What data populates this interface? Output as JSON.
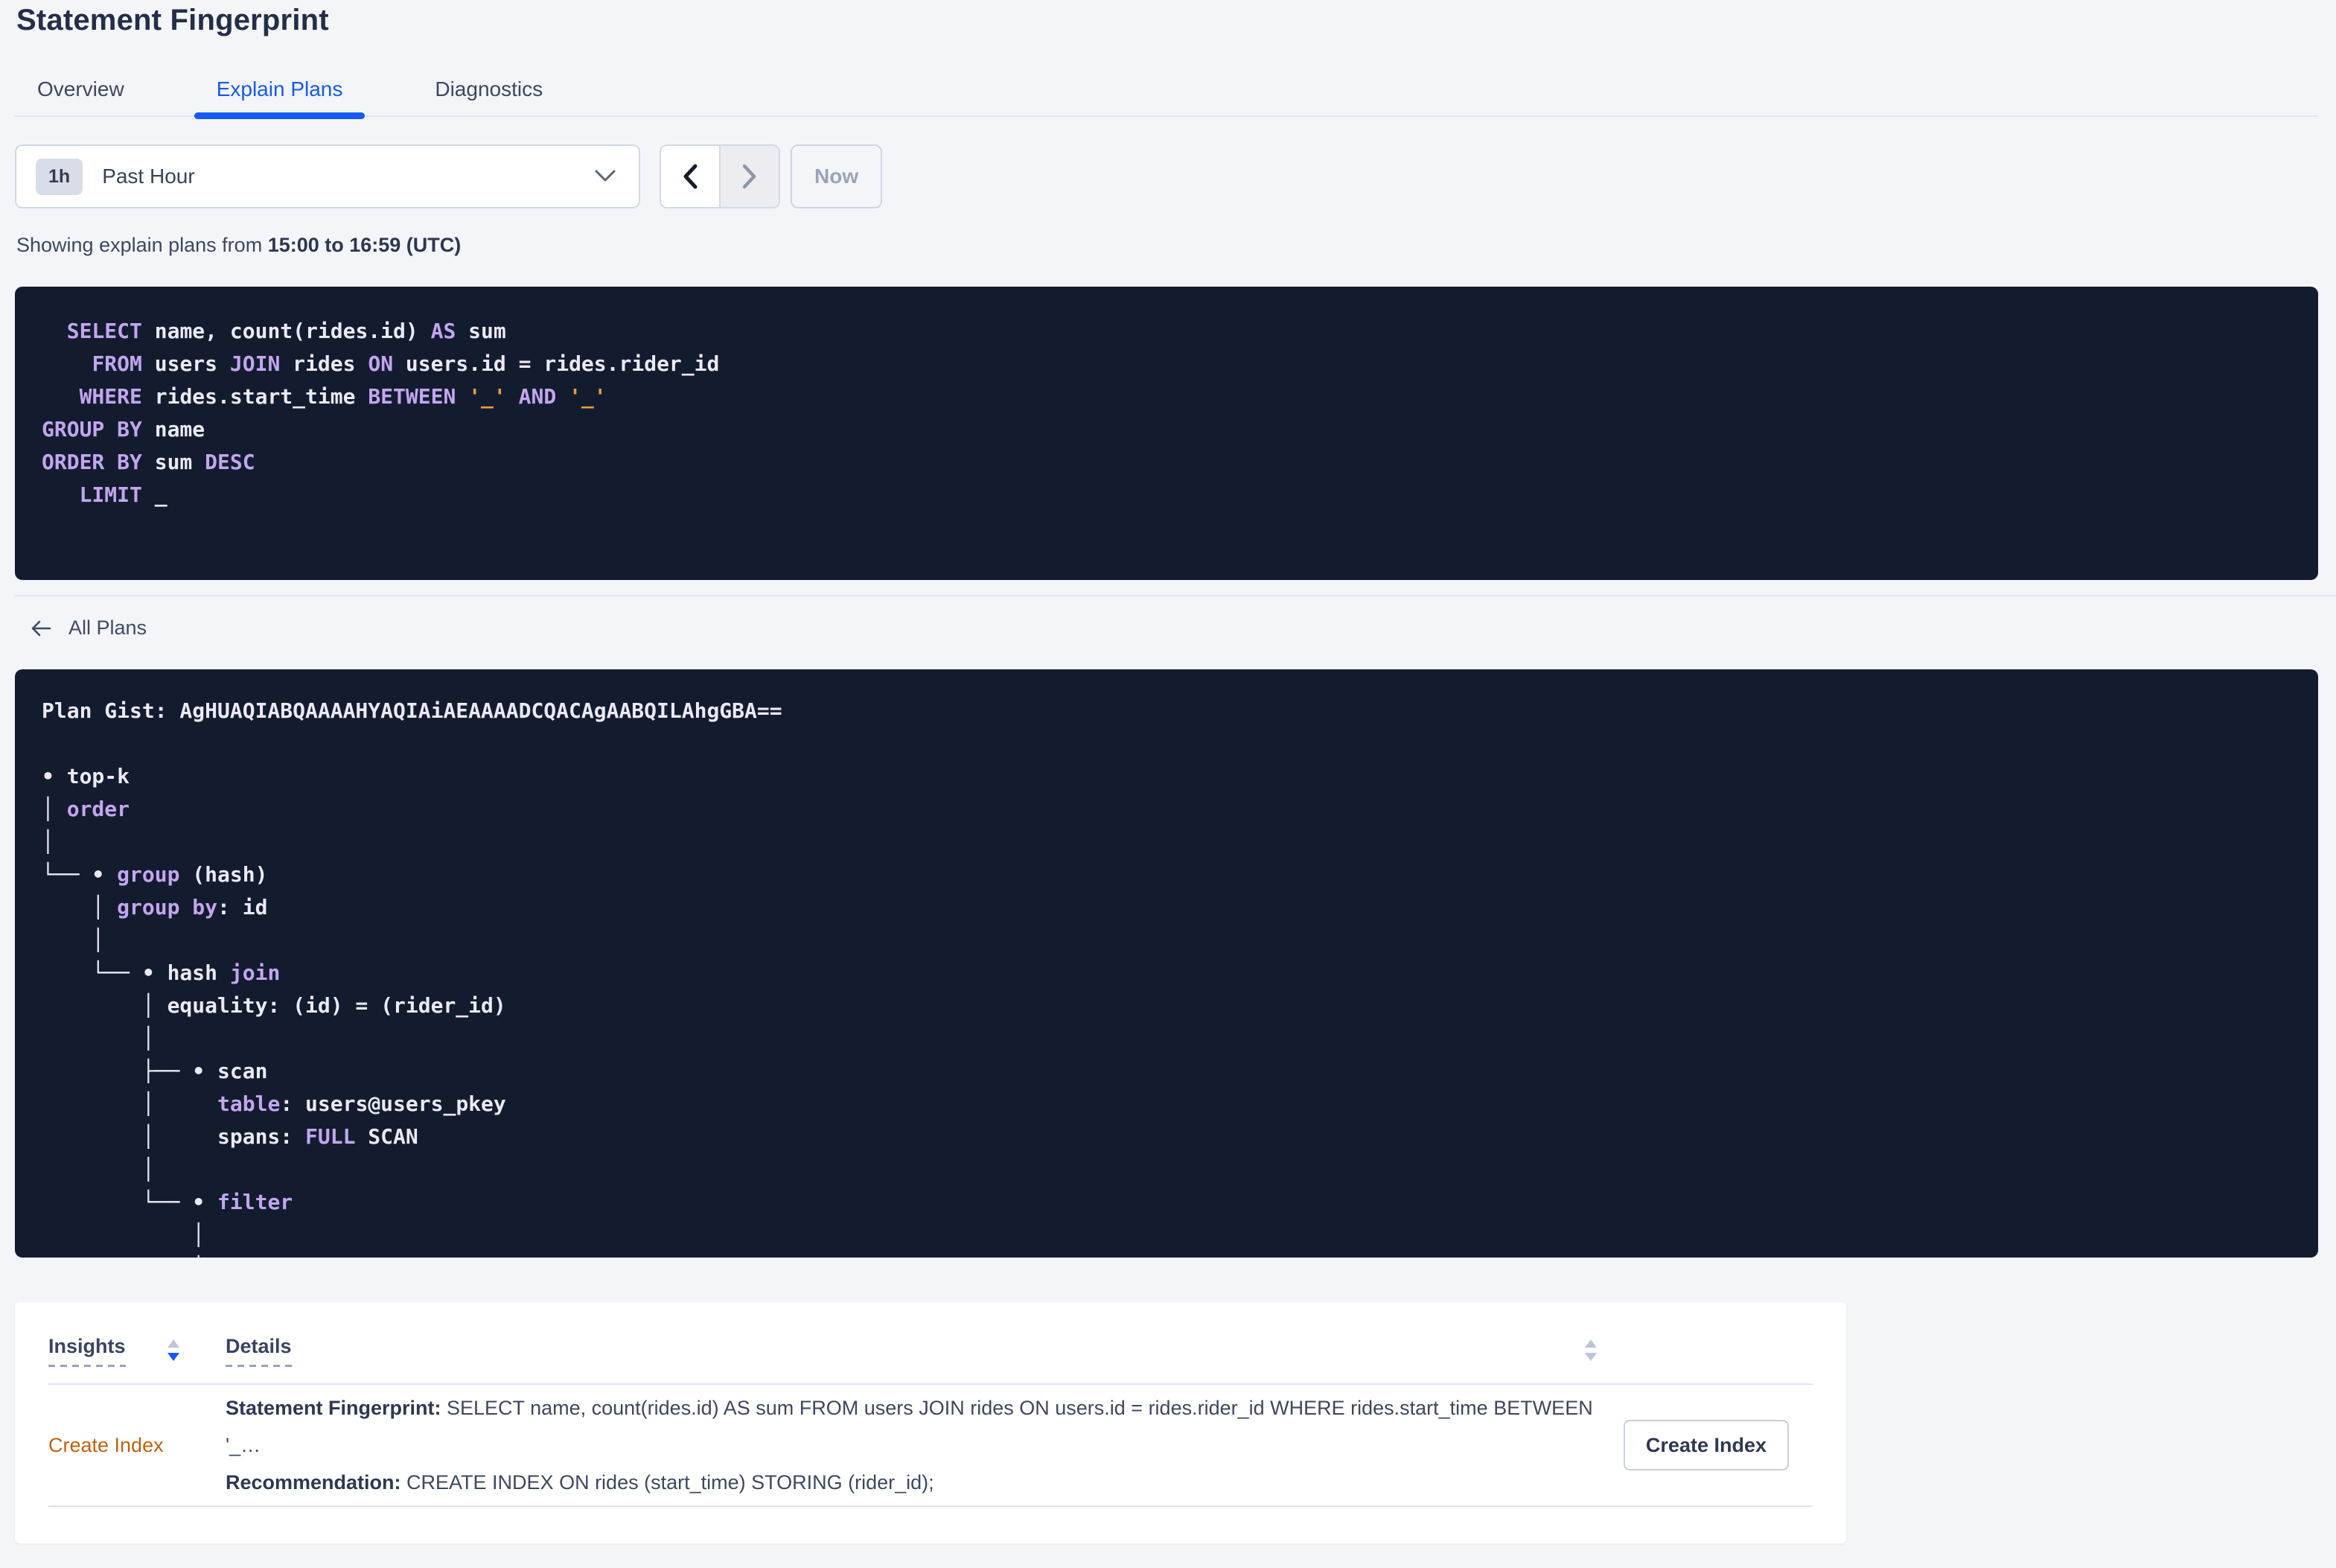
{
  "page": {
    "title": "Statement Fingerprint"
  },
  "tabs": [
    {
      "label": "Overview",
      "active": false
    },
    {
      "label": "Explain Plans",
      "active": true
    },
    {
      "label": "Diagnostics",
      "active": false
    }
  ],
  "time_picker": {
    "badge": "1h",
    "label": "Past Hour",
    "now_label": "Now"
  },
  "showing": {
    "prefix": "Showing explain plans from ",
    "range": "15:00 to 16:59 (UTC)"
  },
  "sql_block": {
    "lines": [
      [
        [
          "p",
          "  "
        ],
        [
          "k",
          "SELECT"
        ],
        [
          "p",
          " name, count(rides.id) "
        ],
        [
          "k",
          "AS"
        ],
        [
          "p",
          " sum"
        ]
      ],
      [
        [
          "p",
          "    "
        ],
        [
          "k",
          "FROM"
        ],
        [
          "p",
          " users "
        ],
        [
          "k",
          "JOIN"
        ],
        [
          "p",
          " rides "
        ],
        [
          "k",
          "ON"
        ],
        [
          "p",
          " users.id = rides.rider_id"
        ]
      ],
      [
        [
          "p",
          "   "
        ],
        [
          "k",
          "WHERE"
        ],
        [
          "p",
          " rides.start_time "
        ],
        [
          "k",
          "BETWEEN"
        ],
        [
          "p",
          " "
        ],
        [
          "o",
          "'_'"
        ],
        [
          "p",
          " "
        ],
        [
          "k",
          "AND"
        ],
        [
          "p",
          " "
        ],
        [
          "o",
          "'_'"
        ]
      ],
      [
        [
          "k",
          "GROUP BY"
        ],
        [
          "p",
          " name"
        ]
      ],
      [
        [
          "k",
          "ORDER BY"
        ],
        [
          "p",
          " sum "
        ],
        [
          "k",
          "DESC"
        ]
      ],
      [
        [
          "p",
          "   "
        ],
        [
          "k",
          "LIMIT"
        ],
        [
          "p",
          " _"
        ]
      ]
    ]
  },
  "all_plans_label": "All Plans",
  "plan_block": {
    "lines": [
      [
        [
          "p",
          "Plan Gist: AgHUAQIABQAAAAHYAQIAiAEAAAADCQACAgAABQILAhgGBA=="
        ]
      ],
      [],
      [
        [
          "p",
          "• top-k"
        ]
      ],
      [
        [
          "p",
          "│ "
        ],
        [
          "k",
          "order"
        ]
      ],
      [
        [
          "p",
          "│"
        ]
      ],
      [
        [
          "p",
          "└── • "
        ],
        [
          "k",
          "group"
        ],
        [
          "p",
          " (hash)"
        ]
      ],
      [
        [
          "p",
          "    │ "
        ],
        [
          "k",
          "group by"
        ],
        [
          "p",
          ": id"
        ]
      ],
      [
        [
          "p",
          "    │"
        ]
      ],
      [
        [
          "p",
          "    └── • hash "
        ],
        [
          "k",
          "join"
        ]
      ],
      [
        [
          "p",
          "        │ equality: (id) = (rider_id)"
        ]
      ],
      [
        [
          "p",
          "        │"
        ]
      ],
      [
        [
          "p",
          "        ├── • scan"
        ]
      ],
      [
        [
          "p",
          "        │     "
        ],
        [
          "k",
          "table"
        ],
        [
          "p",
          ": users@users_pkey"
        ]
      ],
      [
        [
          "p",
          "        │     spans: "
        ],
        [
          "k",
          "FULL"
        ],
        [
          "p",
          " SCAN"
        ]
      ],
      [
        [
          "p",
          "        │"
        ]
      ],
      [
        [
          "p",
          "        └── • "
        ],
        [
          "k",
          "filter"
        ]
      ],
      [
        [
          "p",
          "            │"
        ]
      ],
      [
        [
          "p",
          "            │"
        ]
      ]
    ]
  },
  "insights_table": {
    "columns": {
      "insights": "Insights",
      "details": "Details"
    },
    "row": {
      "insight": "Create Index",
      "fingerprint_label": "Statement Fingerprint:",
      "fingerprint": " SELECT name, count(rides.id) AS sum FROM users JOIN rides ON users.id = rides.rider_id WHERE rides.start_time BETWEEN '_…",
      "recommendation_label": "Recommendation:",
      "recommendation": " CREATE INDEX ON rides (start_time) STORING (rider_id);",
      "action": "Create Index"
    }
  },
  "colors": {
    "accent_blue": "#155af2",
    "code_background": "#131c2f",
    "code_keyword": "#c3a6ef",
    "code_placeholder": "#e69e3d",
    "insight_link_orange": "#c2610e"
  }
}
